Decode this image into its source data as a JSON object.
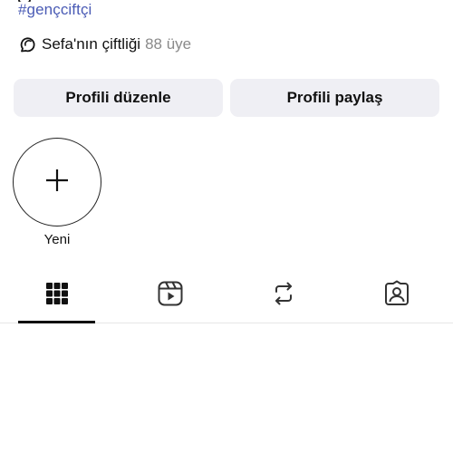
{
  "profile": {
    "hashtag": "#gençciftçi",
    "community": {
      "icon": "threads-community-icon",
      "name": "Sefa'nın çiftliği",
      "members": "88 üye"
    }
  },
  "actions": {
    "edit_label": "Profili düzenle",
    "share_label": "Profili paylaş"
  },
  "highlights": {
    "new_label": "Yeni",
    "new_icon": "plus-icon"
  },
  "tabs": [
    {
      "icon": "grid-icon",
      "active": true
    },
    {
      "icon": "reels-icon",
      "active": false
    },
    {
      "icon": "repost-icon",
      "active": false
    },
    {
      "icon": "tagged-icon",
      "active": false
    }
  ],
  "colors": {
    "hashtag": "#4a5bb5",
    "button_bg": "#efeff4",
    "muted_text": "#8a8a8a"
  }
}
